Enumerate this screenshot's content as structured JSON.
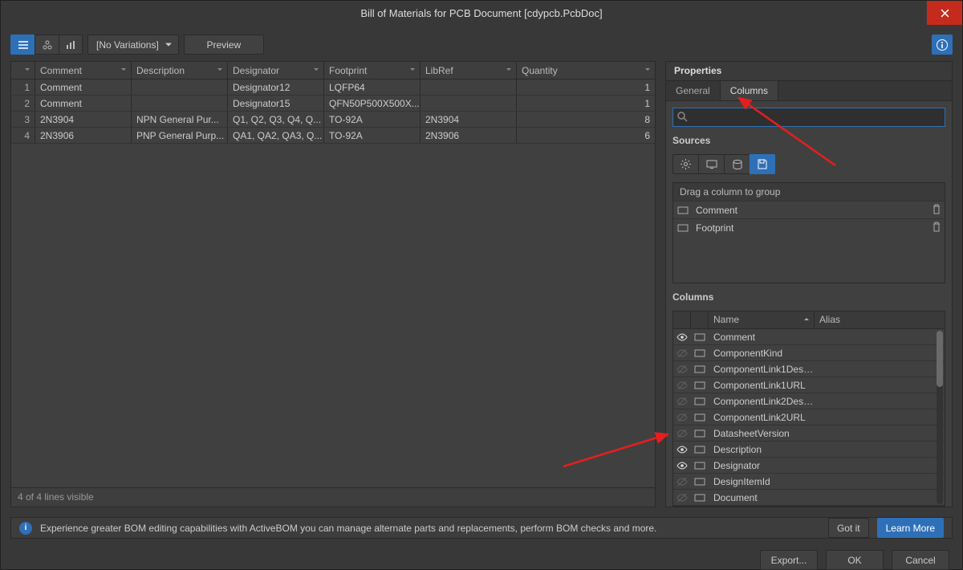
{
  "title": "Bill of Materials for PCB Document [cdypcb.PcbDoc]",
  "toolbar": {
    "variations": "[No Variations]",
    "preview": "Preview"
  },
  "grid": {
    "headers": [
      "Comment",
      "Description",
      "Designator",
      "Footprint",
      "LibRef",
      "Quantity"
    ],
    "rows": [
      {
        "n": "1",
        "comment": "Comment",
        "desc": "",
        "desig": "Designator12",
        "foot": "LQFP64",
        "lib": "",
        "qty": "1"
      },
      {
        "n": "2",
        "comment": "Comment",
        "desc": "",
        "desig": "Designator15",
        "foot": "QFN50P500X500X...",
        "lib": "",
        "qty": "1"
      },
      {
        "n": "3",
        "comment": "2N3904",
        "desc": "NPN General Pur...",
        "desig": "Q1, Q2, Q3, Q4, Q...",
        "foot": "TO-92A",
        "lib": "2N3904",
        "qty": "8"
      },
      {
        "n": "4",
        "comment": "2N3906",
        "desc": "PNP General Purp...",
        "desig": "QA1, QA2, QA3, Q...",
        "foot": "TO-92A",
        "lib": "2N3906",
        "qty": "6"
      }
    ],
    "footer": "4 of 4 lines visible"
  },
  "panel": {
    "title": "Properties",
    "tabs": {
      "general": "General",
      "columns": "Columns"
    },
    "search_placeholder": "",
    "sources_label": "Sources",
    "group_label": "Drag a column to group",
    "group_items": [
      "Comment",
      "Footprint"
    ],
    "columns_label": "Columns",
    "col_headers": {
      "name": "Name",
      "alias": "Alias"
    },
    "col_items": [
      {
        "name": "Comment",
        "visible": true
      },
      {
        "name": "ComponentKind",
        "visible": false
      },
      {
        "name": "ComponentLink1Desc...",
        "visible": false
      },
      {
        "name": "ComponentLink1URL",
        "visible": false
      },
      {
        "name": "ComponentLink2Desc...",
        "visible": false
      },
      {
        "name": "ComponentLink2URL",
        "visible": false
      },
      {
        "name": "DatasheetVersion",
        "visible": false
      },
      {
        "name": "Description",
        "visible": true
      },
      {
        "name": "Designator",
        "visible": true
      },
      {
        "name": "DesignItemId",
        "visible": false
      },
      {
        "name": "Document",
        "visible": false
      }
    ]
  },
  "banner": {
    "msg": "Experience greater BOM editing capabilities with ActiveBOM you can manage alternate parts and replacements, perform BOM checks and more.",
    "gotit": "Got it",
    "learn": "Learn More"
  },
  "footer": {
    "export": "Export...",
    "ok": "OK",
    "cancel": "Cancel"
  }
}
